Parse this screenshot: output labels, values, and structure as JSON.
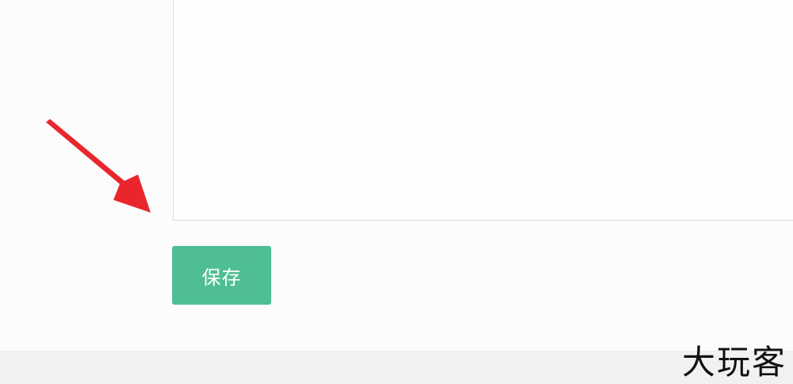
{
  "form": {
    "save_label": "保存"
  },
  "watermark": {
    "text": "大玩客"
  },
  "colors": {
    "save_button": "#4fbf93",
    "arrow": "#e8262c"
  },
  "icons": {
    "annotation": "red-arrow-icon"
  }
}
